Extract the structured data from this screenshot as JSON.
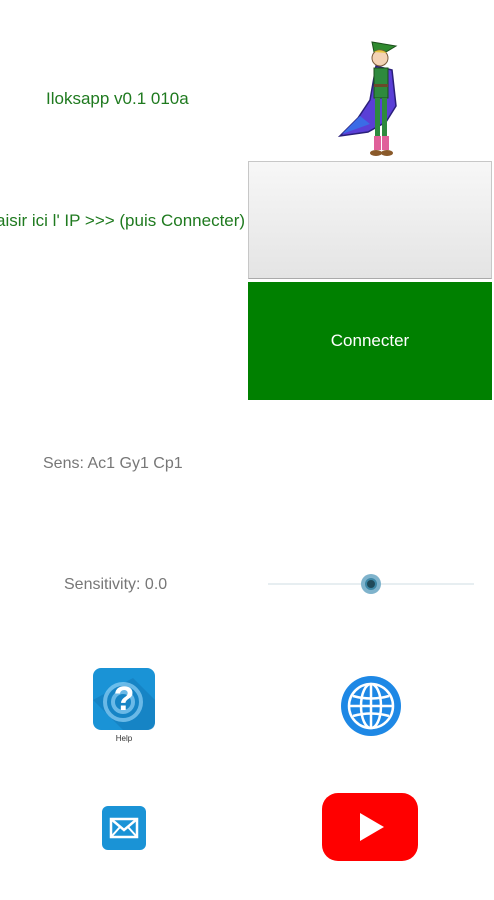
{
  "app": {
    "title": "Iloksapp v0.1 010a"
  },
  "connection": {
    "ip_prompt": "aisir ici l' IP >>> (puis Connecter)",
    "ip_value": "",
    "connect_label": "Connecter"
  },
  "sensors": {
    "sens_label": "Sens:  Ac1 Gy1 Cp1",
    "sensitivity_label": "Sensitivity: 0.0",
    "sensitivity_slider_value": 0.5
  },
  "links": {
    "help_label": "Help"
  },
  "icons": {
    "wizard": "wizard-character-icon",
    "help": "help-icon",
    "web": "globe-icon",
    "mail": "mail-icon",
    "youtube": "youtube-icon"
  },
  "colors": {
    "accent_green": "#008000",
    "text_green": "#1f7a1f",
    "youtube_red": "#ff0000",
    "icon_blue": "#1e88e5"
  }
}
